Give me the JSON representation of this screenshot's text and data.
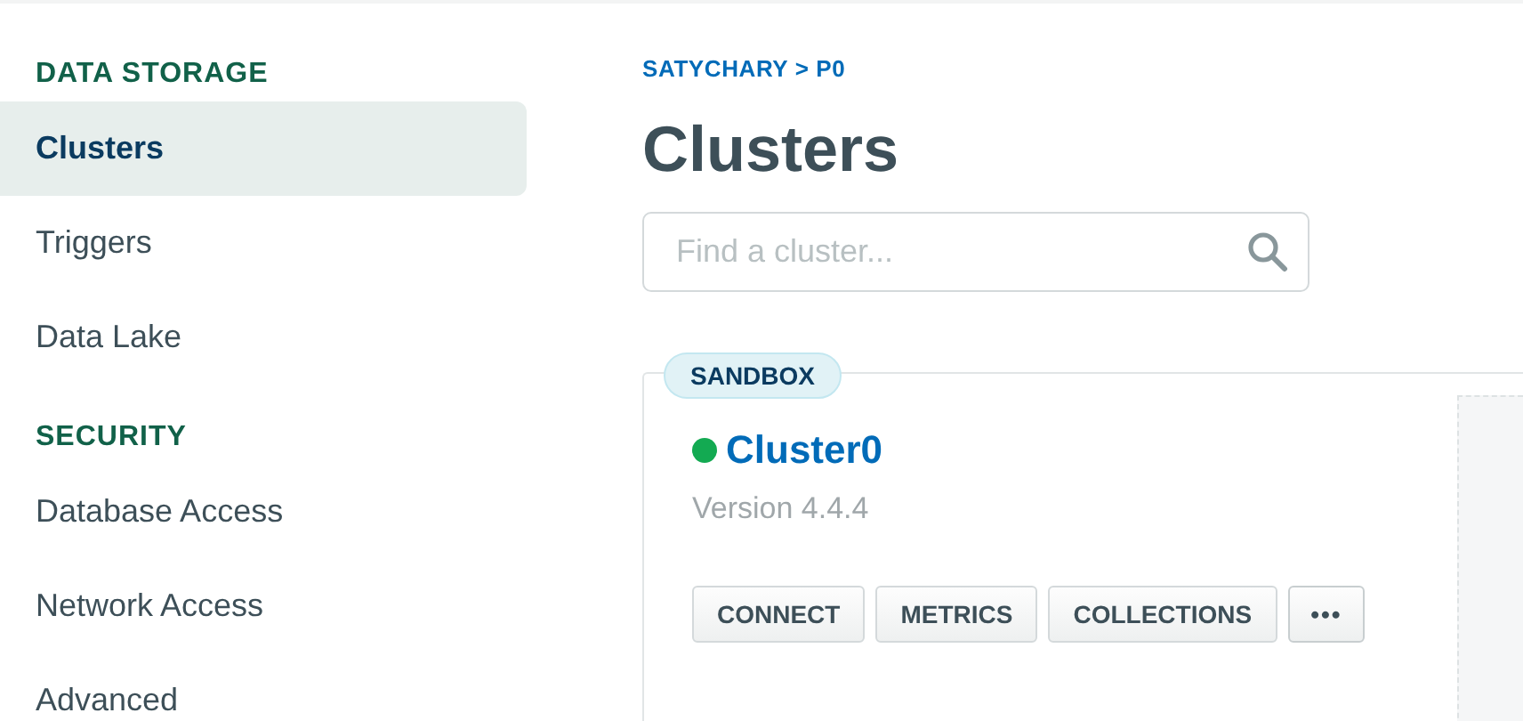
{
  "sidebar": {
    "sections": [
      {
        "heading": "DATA STORAGE",
        "items": [
          {
            "label": "Clusters",
            "selected": true
          },
          {
            "label": "Triggers",
            "selected": false
          },
          {
            "label": "Data Lake",
            "selected": false
          }
        ]
      },
      {
        "heading": "SECURITY",
        "items": [
          {
            "label": "Database Access",
            "selected": false
          },
          {
            "label": "Network Access",
            "selected": false
          },
          {
            "label": "Advanced",
            "selected": false
          }
        ]
      }
    ]
  },
  "breadcrumb": "SATYCHARY > P0",
  "title": "Clusters",
  "search": {
    "placeholder": "Find a cluster..."
  },
  "clusters": [
    {
      "badge": "SANDBOX",
      "name": "Cluster0",
      "color": "#13aa52",
      "version": "Version 4.4.4",
      "buttons": [
        {
          "label": "CONNECT",
          "kind": "text"
        },
        {
          "label": "METRICS",
          "kind": "text"
        },
        {
          "label": "COLLECTIONS",
          "kind": "text"
        },
        {
          "label": "•••",
          "kind": "more"
        }
      ]
    }
  ]
}
